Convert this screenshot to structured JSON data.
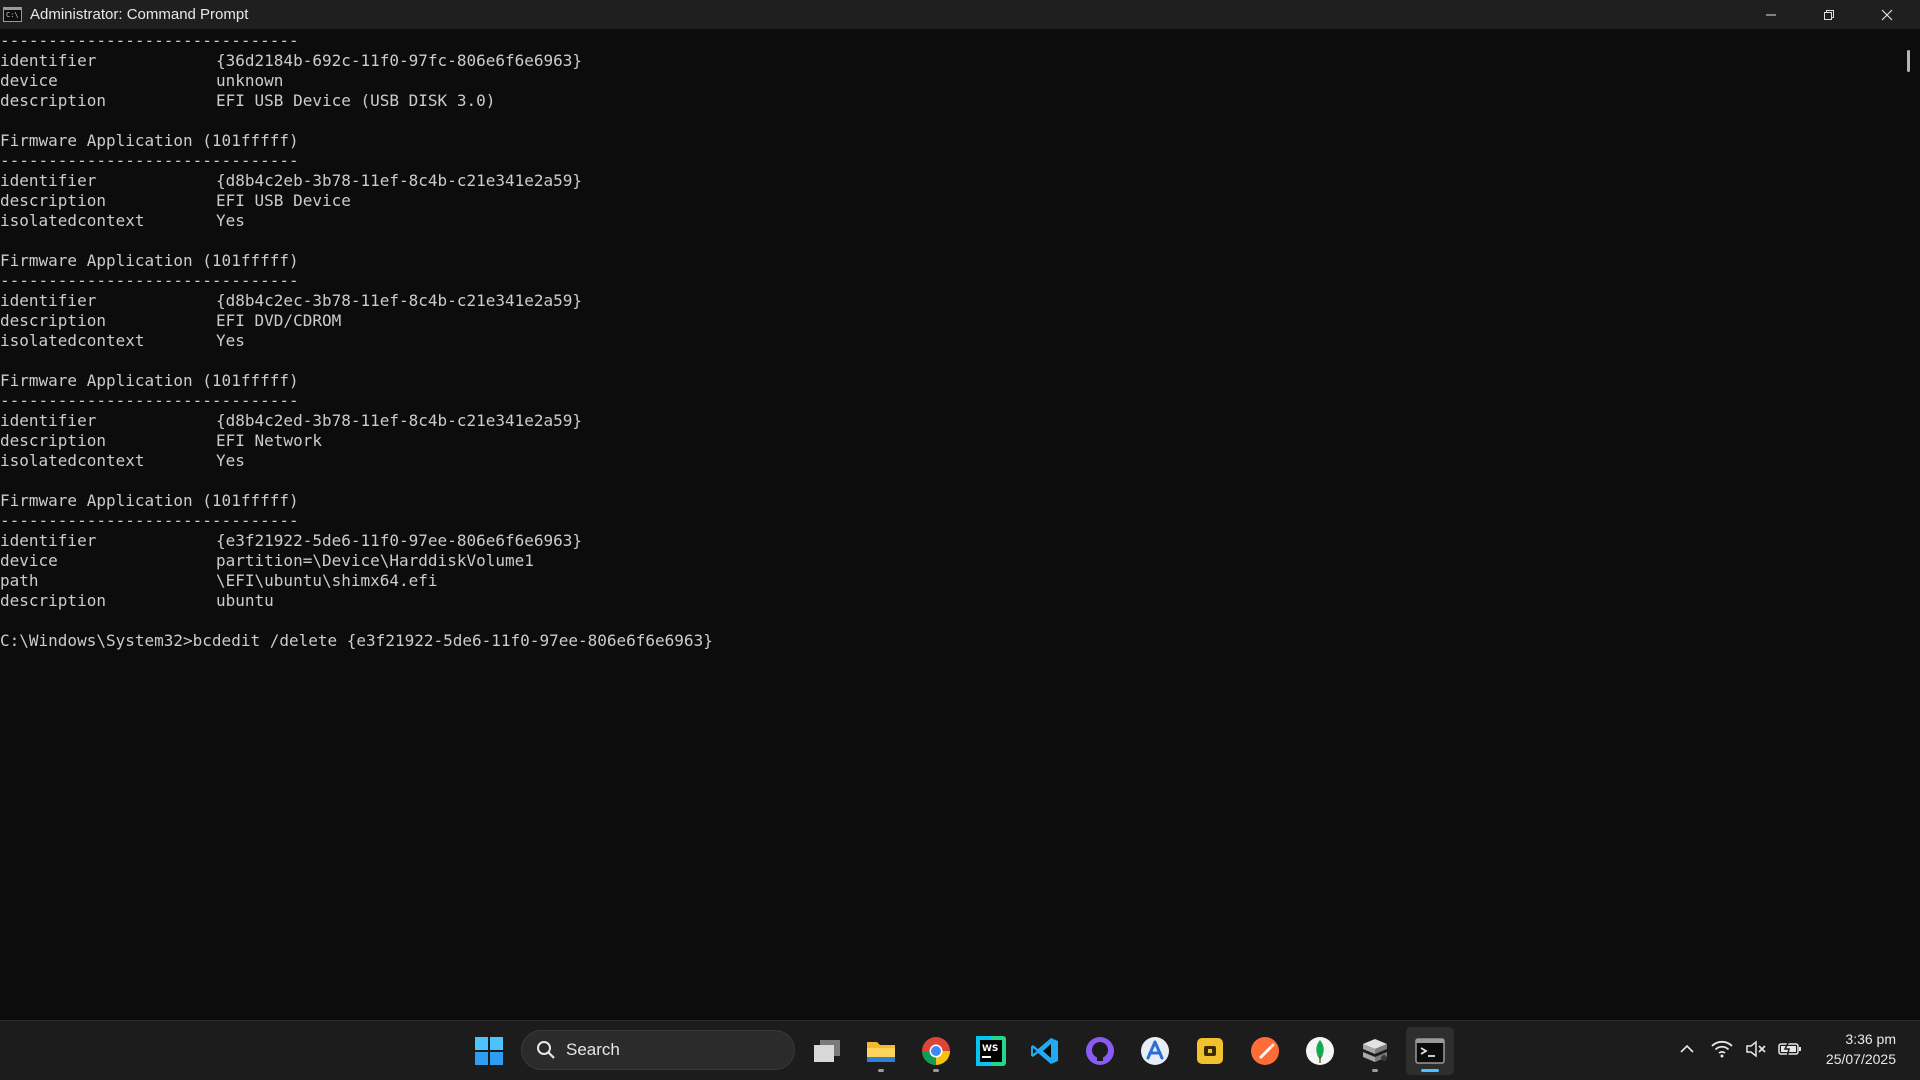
{
  "window": {
    "title": "Administrator: Command Prompt",
    "icon_text": "C:\\"
  },
  "terminal": {
    "lines": [
      {
        "text": "-------------------------------"
      },
      {
        "key": "identifier",
        "value": "{36d2184b-692c-11f0-97fc-806e6f6e6963}"
      },
      {
        "key": "device",
        "value": "unknown"
      },
      {
        "key": "description",
        "value": "EFI USB Device (USB DISK 3.0)"
      },
      {
        "text": ""
      },
      {
        "text": "Firmware Application (101fffff)"
      },
      {
        "text": "-------------------------------"
      },
      {
        "key": "identifier",
        "value": "{d8b4c2eb-3b78-11ef-8c4b-c21e341e2a59}"
      },
      {
        "key": "description",
        "value": "EFI USB Device"
      },
      {
        "key": "isolatedcontext",
        "value": "Yes"
      },
      {
        "text": ""
      },
      {
        "text": "Firmware Application (101fffff)"
      },
      {
        "text": "-------------------------------"
      },
      {
        "key": "identifier",
        "value": "{d8b4c2ec-3b78-11ef-8c4b-c21e341e2a59}"
      },
      {
        "key": "description",
        "value": "EFI DVD/CDROM"
      },
      {
        "key": "isolatedcontext",
        "value": "Yes"
      },
      {
        "text": ""
      },
      {
        "text": "Firmware Application (101fffff)"
      },
      {
        "text": "-------------------------------"
      },
      {
        "key": "identifier",
        "value": "{d8b4c2ed-3b78-11ef-8c4b-c21e341e2a59}"
      },
      {
        "key": "description",
        "value": "EFI Network"
      },
      {
        "key": "isolatedcontext",
        "value": "Yes"
      },
      {
        "text": ""
      },
      {
        "text": "Firmware Application (101fffff)"
      },
      {
        "text": "-------------------------------"
      },
      {
        "key": "identifier",
        "value": "{e3f21922-5de6-11f0-97ee-806e6f6e6963}"
      },
      {
        "key": "device",
        "value": "partition=\\Device\\HarddiskVolume1"
      },
      {
        "key": "path",
        "value": "\\EFI\\ubuntu\\shimx64.efi"
      },
      {
        "key": "description",
        "value": "ubuntu"
      },
      {
        "text": ""
      },
      {
        "text": "C:\\Windows\\System32>bcdedit /delete {e3f21922-5de6-11f0-97ee-806e6f6e6963}",
        "prompt": true
      }
    ]
  },
  "taskbar": {
    "search_label": "Search",
    "apps": [
      {
        "id": "start",
        "icon": "windows-logo-icon"
      },
      {
        "id": "task-view",
        "icon": "task-view-icon"
      },
      {
        "id": "file-explorer",
        "icon": "folder-icon",
        "running": true
      },
      {
        "id": "chrome",
        "icon": "chrome-icon",
        "running": true
      },
      {
        "id": "webstorm",
        "icon": "webstorm-icon"
      },
      {
        "id": "vscode",
        "icon": "vscode-icon"
      },
      {
        "id": "github-desktop",
        "icon": "github-icon"
      },
      {
        "id": "app-store",
        "icon": "app-store-icon"
      },
      {
        "id": "yellow-app",
        "icon": "yellow-square-icon"
      },
      {
        "id": "postman",
        "icon": "postman-icon"
      },
      {
        "id": "mongodb",
        "icon": "mongodb-leaf-icon"
      },
      {
        "id": "server-app",
        "icon": "server-stack-icon",
        "running": true
      },
      {
        "id": "terminal",
        "icon": "terminal-icon",
        "active": true
      }
    ]
  },
  "tray": {
    "time": "3:36 pm",
    "date": "25/07/2025"
  },
  "colors": {
    "terminal_bg": "#0c0c0c",
    "terminal_fg": "#cccccc",
    "titlebar_bg": "#1f1f1f",
    "taskbar_bg": "#1c1c1c",
    "accent": "#4cc2ff"
  }
}
